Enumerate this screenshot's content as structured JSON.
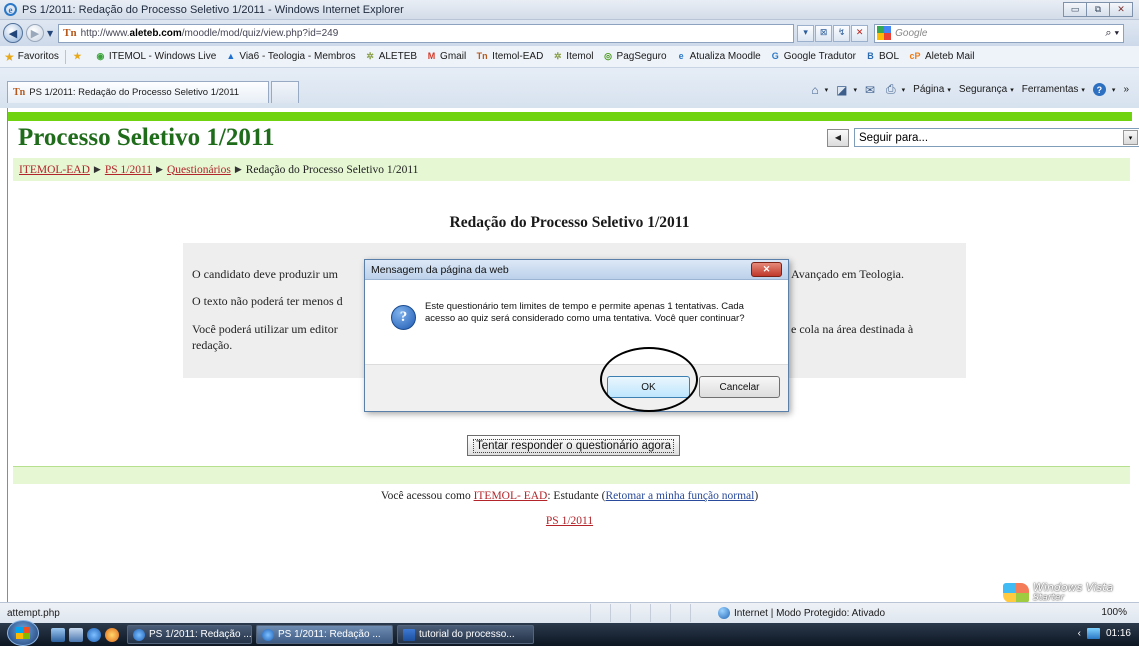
{
  "window": {
    "title": "PS 1/2011: Redação do Processo Seletivo 1/2011 - Windows Internet Explorer",
    "ie_glyph": "e",
    "min_glyph": "▭",
    "max_glyph": "⧉",
    "close_glyph": "✕"
  },
  "addressbar": {
    "back_glyph": "◀",
    "forward_glyph": "▶",
    "dropdown_glyph": "▼",
    "site_logo": "Tn",
    "url_prefix": "http://www.",
    "url_domain": "aleteb.com",
    "url_path": "/moodle/mod/quiz/view.php?id=249",
    "url_dropdown": "▾",
    "compat_glyph": "⊠",
    "refresh_glyph": "↯",
    "stop_glyph": "✕",
    "search_placeholder": "Google",
    "search_glyph": "⌕ ▾"
  },
  "favorites": {
    "label": "Favoritos",
    "items": [
      {
        "icon": "★",
        "color": "#e7a91a",
        "label": ""
      },
      {
        "icon": "◉",
        "color": "#3aa43a",
        "label": "ITEMOL - Windows Live"
      },
      {
        "icon": "▲",
        "color": "#1e6fd0",
        "label": "Via6 - Teologia - Membros"
      },
      {
        "icon": "✲",
        "color": "#8aa04a",
        "label": "ALETEB"
      },
      {
        "icon": "M",
        "color": "#d23a2a",
        "label": "Gmail"
      },
      {
        "icon": "Tn",
        "color": "#b7581a",
        "label": "Itemol-EAD"
      },
      {
        "icon": "✲",
        "color": "#8aa04a",
        "label": "Itemol"
      },
      {
        "icon": "◎",
        "color": "#4a9a1e",
        "label": "PagSeguro"
      },
      {
        "icon": "e",
        "color": "#2c78c8",
        "label": "Atualiza Moodle"
      },
      {
        "icon": "G",
        "color": "#2c78c8",
        "label": "Google Tradutor"
      },
      {
        "icon": "B",
        "color": "#2a6ab0",
        "label": "BOL"
      },
      {
        "icon": "cP",
        "color": "#f07a10",
        "label": "Aleteb Mail"
      }
    ]
  },
  "tabs": {
    "active_label": "PS 1/2011: Redação do Processo Seletivo 1/2011",
    "commands": {
      "home_glyph": "⌂",
      "feeds_glyph": "◪",
      "mail_glyph": "✉",
      "print_glyph": "⎙",
      "page": "Página",
      "security": "Segurança",
      "tools": "Ferramentas",
      "help_glyph": "?",
      "dropdown_glyph": "▾",
      "overflow_glyph": "»"
    }
  },
  "page": {
    "heading": "Processo Seletivo 1/2011",
    "jump_prev_glyph": "◀",
    "jump_label": "Seguir para...",
    "jump_arrow": "▾",
    "breadcrumb": {
      "home": "ITEMOL-EAD",
      "course": "PS 1/2011",
      "section": "Questionários",
      "current": "Redação do Processo Seletivo 1/2011",
      "separator": "▶"
    },
    "quiz_title": "Redação do Processo Seletivo 1/2011",
    "intro": {
      "line1_start": "O candidato deve produzir um",
      "line1_end": "Avançado em Teologia.",
      "line2": "O texto não poderá ter menos d",
      "line3_start": "Você poderá utilizar um editor",
      "line3_end": "e cola na área destinada à",
      "line4": "redação."
    },
    "attempt_button": "Tentar responder o questionário agora",
    "footer": {
      "logged_as": "Você acessou como",
      "user": "ITEMOL- EAD",
      "role": "Estudante",
      "return_link": "Retomar a minha função normal",
      "home_link": "PS 1/2011"
    }
  },
  "dialog": {
    "title": "Mensagem da página da web",
    "close_glyph": "✕",
    "icon_glyph": "?",
    "message": "Este questionário tem limites de tempo e permite apenas 1 tentativas. Cada acesso ao quiz será considerado como uma tentativa. Você quer continuar?",
    "ok": "OK",
    "cancel": "Cancelar"
  },
  "statusbar": {
    "text": "attempt.php",
    "zone": "Internet | Modo Protegido: Ativado",
    "zoom": "100%"
  },
  "watermark": {
    "text": "Windows Vista",
    "sub": "Starter"
  },
  "taskbar": {
    "tasks": [
      {
        "label": "PS 1/2011: Redação ...",
        "type": "ie"
      },
      {
        "label": "PS 1/2011: Redação ...",
        "type": "ie"
      },
      {
        "label": "tutorial do processo...",
        "type": "doc"
      }
    ],
    "tray_arrow": "‹",
    "clock": "01:16"
  }
}
